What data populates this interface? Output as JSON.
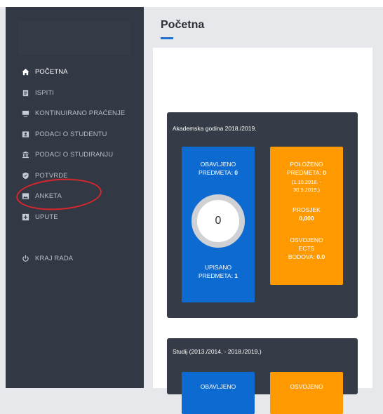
{
  "sidebar": {
    "items": [
      {
        "label": "POČETNA",
        "icon": "home-icon",
        "active": true
      },
      {
        "label": "ISPITI",
        "icon": "clipboard-icon"
      },
      {
        "label": "KONTINUIRANO PRAĆENJE",
        "icon": "monitor-icon"
      },
      {
        "label": "PODACI O STUDENTU",
        "icon": "user-card-icon"
      },
      {
        "label": "PODACI O STUDIRANJU",
        "icon": "institution-icon"
      },
      {
        "label": "POTVRDE",
        "icon": "shield-check-icon"
      },
      {
        "label": "ANKETA",
        "icon": "image-icon"
      },
      {
        "label": "UPUTE",
        "icon": "plus-square-icon"
      }
    ],
    "logout": {
      "label": "KRAJ RADA",
      "icon": "power-icon"
    },
    "highlight_color": "#d9262c"
  },
  "page": {
    "title": "Početna"
  },
  "panel1": {
    "title": "Akademska godina 2018./2019.",
    "blue": {
      "passed_label_1": "OBAVLJENO",
      "passed_label_2": "PREDMETA: ",
      "passed_value": "0",
      "circle_value": "0",
      "enrolled_label_1": "UPISANO",
      "enrolled_label_2": "PREDMETA: ",
      "enrolled_value": "1"
    },
    "orange": {
      "passed_label_1": "POLOŽENO",
      "passed_label_2": "PREDMETA: ",
      "passed_value": "0",
      "date_range_1": "(1.10.2018. -",
      "date_range_2": "30.9.2019.)",
      "avg_label": "PROSJEK",
      "avg_value": "0,000",
      "ects_label_1": "OSVOJENO",
      "ects_label_2": "ECTS",
      "ects_label_3": "BODOVA: ",
      "ects_value": "0.0"
    }
  },
  "panel2": {
    "title": "Studij (2013./2014. - 2018./2019.)",
    "blue_label": "OBAVLJENO",
    "orange_label": "OSVOJENO"
  },
  "colors": {
    "sidebar_bg": "#323844",
    "panel_bg": "#353b47",
    "blue": "#0d6ad0",
    "orange": "#ff9900",
    "accent": "#1e74d6"
  }
}
